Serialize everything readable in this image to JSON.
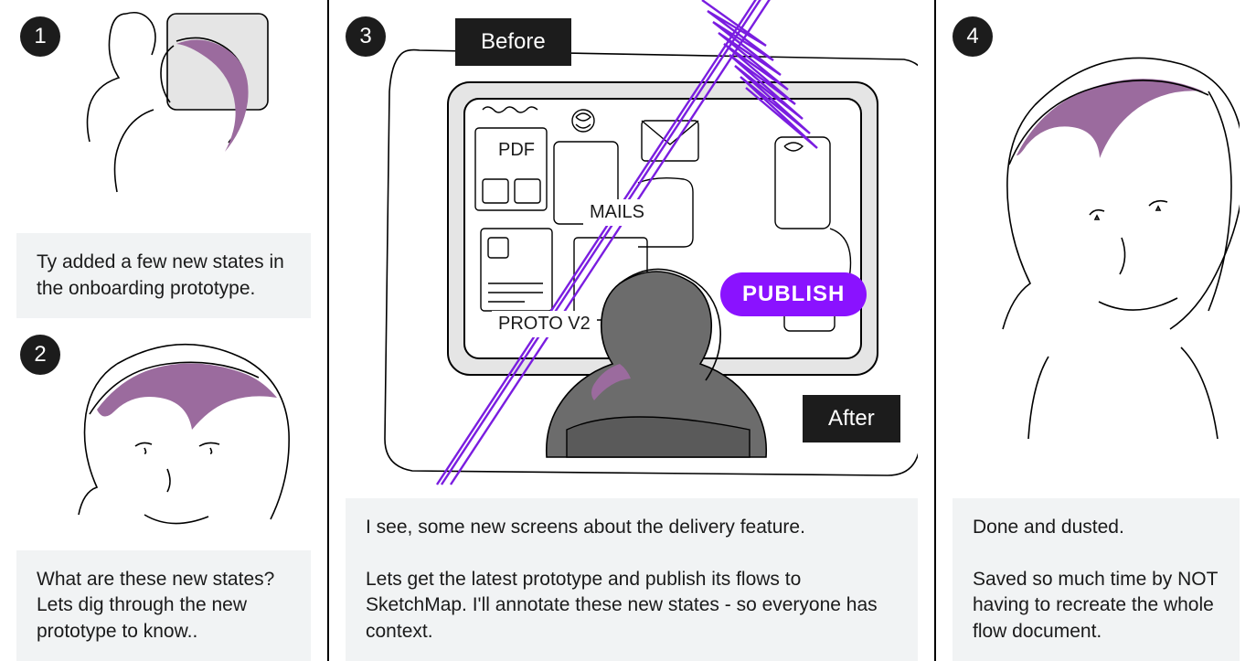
{
  "panels": [
    {
      "num": "1",
      "caption": "Ty added a few new states in the onboarding prototype."
    },
    {
      "num": "2",
      "caption": "What are these new states? Lets dig through the new prototype to know.."
    },
    {
      "num": "3",
      "before_label": "Before",
      "after_label": "After",
      "sketch_labels": {
        "pdf": "PDF",
        "mails": "MAILS",
        "proto": "PROTO V2"
      },
      "publish_label": "PUBLISH",
      "caption": "I see, some new screens about the delivery feature.\n\nLets get the latest prototype and publish its flows to SketchMap. I'll annotate these new states - so everyone has context."
    },
    {
      "num": "4",
      "caption": "Done and dusted.\n\nSaved so much time by NOT having to recreate the whole flow document."
    }
  ],
  "colors": {
    "accent_purple": "#8a12ff",
    "hair_purple": "#9b6b9e",
    "stroke_purple": "#7a1de0"
  }
}
